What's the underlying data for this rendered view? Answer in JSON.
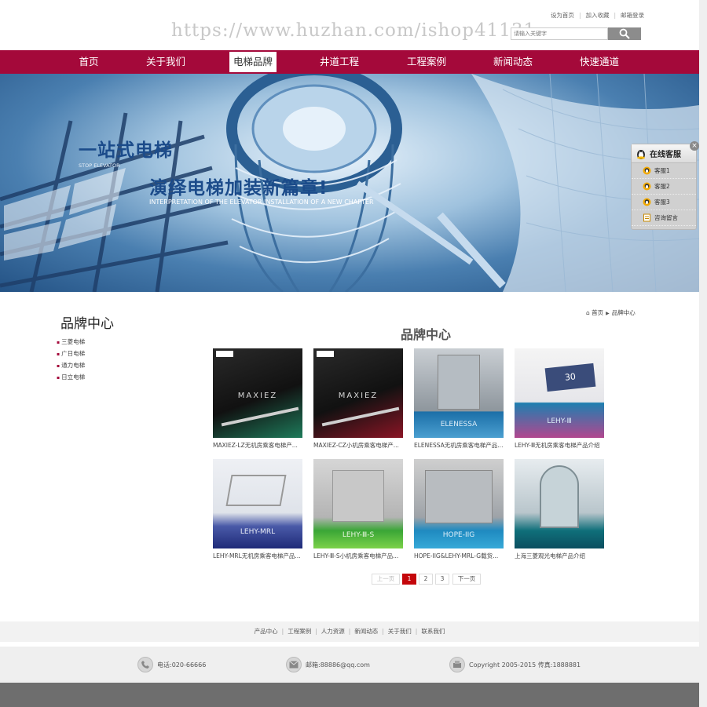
{
  "header": {
    "watermark": "https://www.huzhan.com/ishop41131",
    "links": [
      "设为首页",
      "加入收藏",
      "邮箱登录"
    ],
    "search_placeholder": "请输入关键字"
  },
  "nav": {
    "items": [
      "首页",
      "关于我们",
      "电梯品牌",
      "井道工程",
      "工程案例",
      "新闻动态",
      "快速通道"
    ],
    "active_index": 2
  },
  "banner": {
    "heading1": "一站式电梯",
    "sub1": "STOP ELEVATOR",
    "heading2": "演绎电梯加装新篇章!",
    "sub2": "INTERPRETATION OF THE ELEVATOR INSTALLATION OF A NEW CHAPTER"
  },
  "service": {
    "title": "在线客服",
    "close": "×",
    "items": [
      "客服1",
      "客服2",
      "客服3",
      "咨询留言"
    ]
  },
  "sidebar": {
    "title": "品牌中心",
    "items": [
      "三菱电梯",
      "广日电梯",
      "通力电梯",
      "日立电梯"
    ]
  },
  "breadcrumb": {
    "home": "首页",
    "current": "品牌中心"
  },
  "main": {
    "title": "品牌中心",
    "products": [
      {
        "name": "MAXIEZ-LZ无机房乘客电梯产...",
        "thumb_label": "MAXIEZ"
      },
      {
        "name": "MAXIEZ-CZ小机房乘客电梯产...",
        "thumb_label": "MAXIEZ"
      },
      {
        "name": "ELENESSA无机房乘客电梯产品...",
        "thumb_label": "ELENESSA"
      },
      {
        "name": "LEHY-Ⅲ无机房乘客电梯产品介绍",
        "thumb_label": "LEHY-Ⅲ"
      },
      {
        "name": "LEHY-MRL无机房乘客电梯产品...",
        "thumb_label": "LEHY-MRL"
      },
      {
        "name": "LEHY-Ⅲ-S小机房乘客电梯产品...",
        "thumb_label": "LEHY-Ⅲ-S"
      },
      {
        "name": "HOPE-IIG&LEHY-MRL-G载货...",
        "thumb_label": "HOPE-IIG"
      },
      {
        "name": "上海三菱观光电梯产品介绍",
        "thumb_label": ""
      }
    ]
  },
  "pagination": {
    "prev": "上一页",
    "pages": [
      "1",
      "2",
      "3"
    ],
    "current": "1",
    "next": "下一页"
  },
  "footer": {
    "links": [
      "产品中心",
      "工程案例",
      "人力资源",
      "新闻动态",
      "关于我们",
      "联系我们"
    ],
    "phone": "电话:020-66666",
    "email": "邮箱:88886@qq.com",
    "copyright": "Copyright 2005-2015 传真:1888881"
  },
  "colors": {
    "brand": "#a4093a",
    "pager_current": "#c4060b",
    "banner_text": "#1b4b8a"
  }
}
